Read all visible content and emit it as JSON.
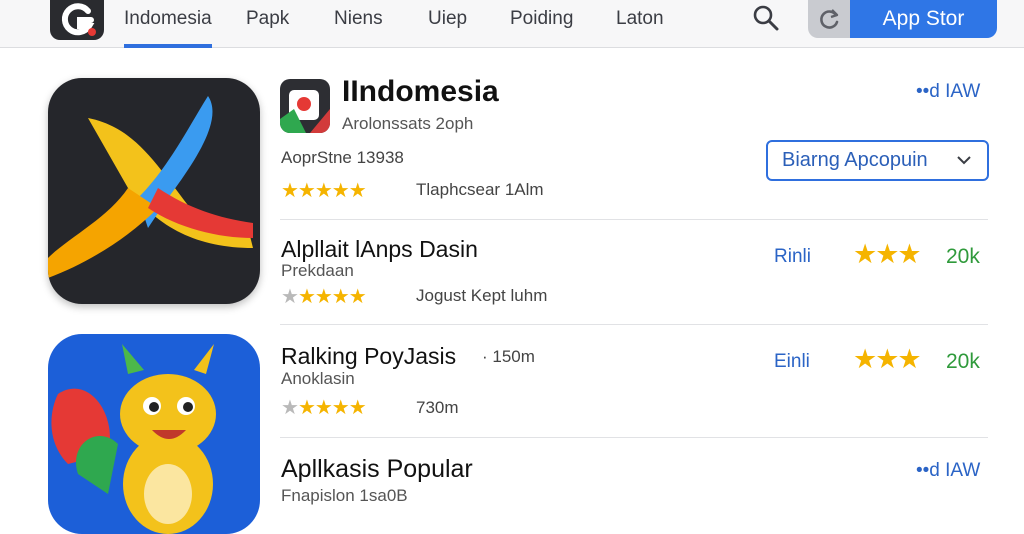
{
  "nav": {
    "tabs": [
      {
        "label": "Indomesia"
      },
      {
        "label": "Papk"
      },
      {
        "label": "Niens"
      },
      {
        "label": "Uiep"
      },
      {
        "label": "Poiding"
      },
      {
        "label": "Laton"
      }
    ],
    "active_tab": 0,
    "store_button": "App Stor"
  },
  "featured": {
    "name": "IIndomesia",
    "developer": "Arolonssats 2oph",
    "store_line": "AoprStne 13938",
    "rating_note": "Tlaphcsear 1Alm",
    "link": "••d IAW",
    "select_value": "Biarng Apcopuin"
  },
  "rows": [
    {
      "title": "Alpllait lAnps Dasin",
      "subtitle": "Prekdaan",
      "rating_note": "Jogust Kept luhm",
      "action": "Rinli",
      "count": "20k",
      "stars_total": 3,
      "stars_small": 5
    },
    {
      "title": "Ralking PoyJasis",
      "size_note": "· 150m",
      "subtitle": "Anoklasin",
      "rating_note": "730m",
      "action": "Einli",
      "count": "20k",
      "stars_total": 3,
      "stars_small": 5
    },
    {
      "title": "Apllkasis Popular",
      "subtitle": "Fnapislon 1sa0B",
      "link": "••d IAW"
    }
  ],
  "colors": {
    "accent": "#2f6fde",
    "star": "#f5b400",
    "count_green": "#2f9a3b",
    "store_blue": "#2f76e6"
  },
  "icons": [
    "logo-icon",
    "search-icon",
    "refresh-icon",
    "chevron-down-icon",
    "star-icon"
  ]
}
